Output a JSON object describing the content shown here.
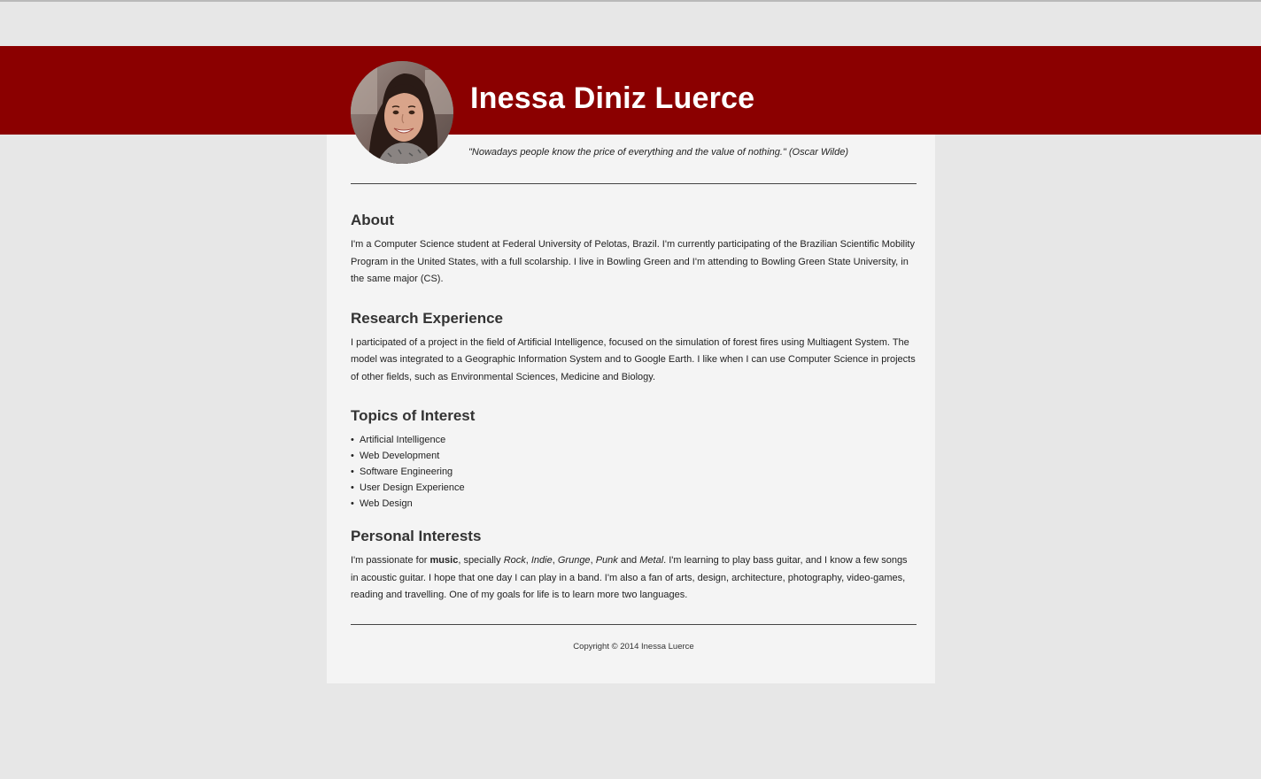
{
  "header": {
    "name": "Inessa Diniz Luerce",
    "quote": "\"Nowadays people know the price of everything and the value of nothing.\" (Oscar Wilde)"
  },
  "about": {
    "heading": "About",
    "text": "I'm a Computer Science student at Federal University of Pelotas, Brazil. I'm currently participating of the Brazilian Scientific Mobility Program in the United States, with a full scolarship. I live in Bowling Green and I'm attending to Bowling Green State University, in the same major (CS)."
  },
  "research": {
    "heading": "Research Experience",
    "text": "I participated of a project in the field of Artificial Intelligence, focused on the simulation of forest fires using Multiagent System. The model was integrated to a Geographic Information System and to Google Earth. I like when I can use Computer Science in projects of other fields, such as Environmental Sciences, Medicine and Biology."
  },
  "topics": {
    "heading": "Topics of Interest",
    "bullet": "•",
    "items": [
      "Artificial Intelligence",
      "Web Development",
      "Software Engineering",
      "User Design Experience",
      "Web Design"
    ]
  },
  "personal": {
    "heading": "Personal Interests",
    "text_1": "I'm passionate for ",
    "music": "music",
    "text_2": ", specially ",
    "rock": "Rock",
    "comma_1": ", ",
    "indie": "Indie",
    "comma_2": ", ",
    "grunge": "Grunge",
    "comma_3": ", ",
    "punk": "Punk",
    "and_word": " and ",
    "metal": "Metal",
    "text_3": ". I'm learning to play bass guitar, and I know a few songs in acoustic guitar. I hope that one day I can play in a band. I'm also a fan of arts, design, architecture, photography, video-games, reading and travelling. One of my goals for life is to learn more two languages."
  },
  "footer": {
    "copyright": "Copyright © 2014 Inessa Luerce"
  },
  "colors": {
    "header_band": "#8b0000",
    "page_background": "#e7e7e7",
    "card_background": "#f4f4f4"
  },
  "icons": {
    "avatar": "profile-photo"
  }
}
